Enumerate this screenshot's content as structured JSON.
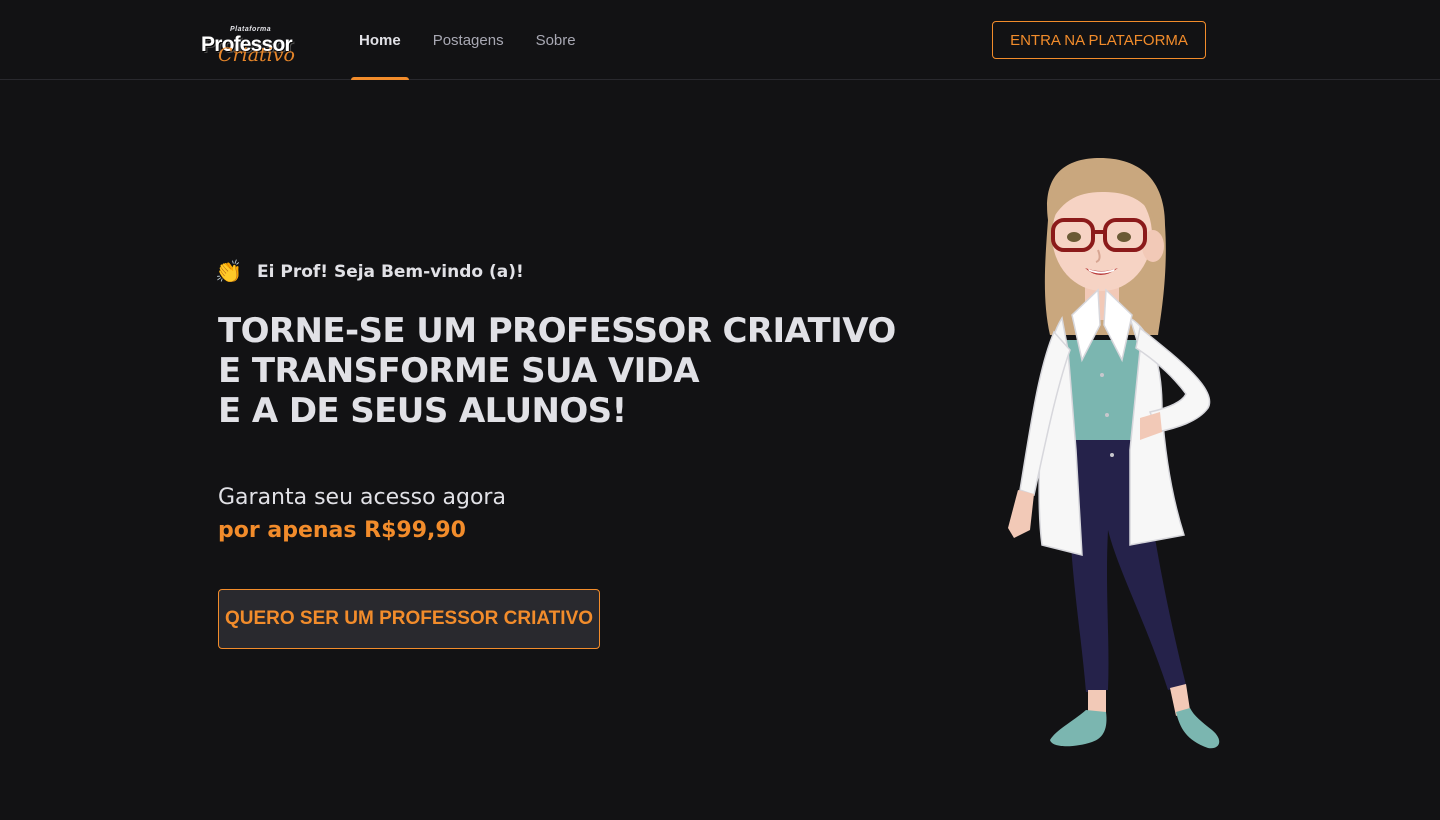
{
  "header": {
    "logo": {
      "small": "Plataforma",
      "main": "Professor",
      "script": "Criativo"
    },
    "nav": [
      {
        "label": "Home",
        "active": true
      },
      {
        "label": "Postagens",
        "active": false
      },
      {
        "label": "Sobre",
        "active": false
      }
    ],
    "cta_label": "ENTRA NA PLATAFORMA"
  },
  "hero": {
    "greeting_icon": "clapping-hands-icon",
    "greeting": "Ei Prof! Seja Bem-vindo (a)!",
    "title_lines": [
      "TORNE-SE UM PROFESSOR CRIATIVO",
      "E TRANSFORME SUA VIDA",
      "E A DE SEUS ALUNOS!"
    ],
    "subtitle": "Garanta seu acesso agora",
    "price": "por apenas R$99,90",
    "cta_label": "QUERO SER UM PROFESSOR CRIATIVO"
  },
  "colors": {
    "background": "#121214",
    "accent": "#f28c2b",
    "text": "#e1e1e6",
    "muted": "#a8a8b3",
    "button_bg": "#29292e"
  }
}
